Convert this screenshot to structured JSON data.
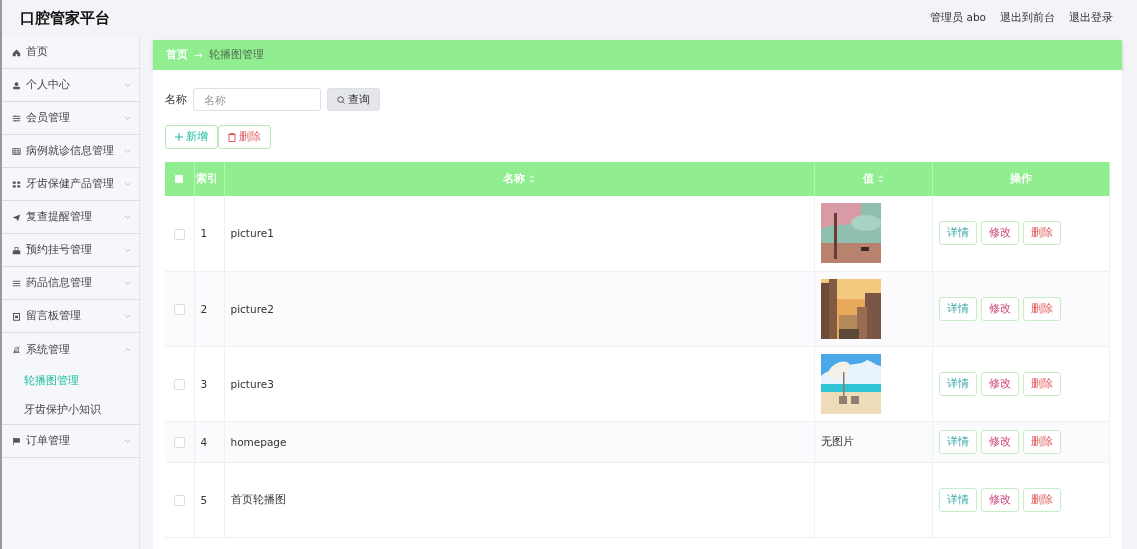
{
  "header": {
    "title": "口腔管家平台",
    "links": [
      "管理员 abo",
      "退出到前台",
      "退出登录"
    ]
  },
  "sidebar": {
    "items": [
      {
        "label": "首页"
      },
      {
        "label": "个人中心",
        "expanded": false
      },
      {
        "label": "会员管理",
        "expanded": false
      },
      {
        "label": "病例就诊信息管理",
        "expanded": false
      },
      {
        "label": "牙齿保健产品管理",
        "expanded": false
      },
      {
        "label": "复查提醒管理",
        "expanded": false
      },
      {
        "label": "预约挂号管理",
        "expanded": false
      },
      {
        "label": "药品信息管理",
        "expanded": false
      },
      {
        "label": "留言板管理",
        "expanded": false
      },
      {
        "label": "系统管理",
        "expanded": true,
        "children": [
          {
            "label": "轮播图管理",
            "selected": true
          },
          {
            "label": "牙齿保护小知识",
            "selected": false
          }
        ]
      },
      {
        "label": "订单管理",
        "expanded": false
      }
    ]
  },
  "breadcrumb": {
    "items": [
      "首页",
      "轮播图管理"
    ],
    "separator": "→"
  },
  "search": {
    "label": "名称",
    "placeholder": "名称",
    "button": "查询"
  },
  "actions": [
    {
      "kind": "add",
      "label": "新增"
    },
    {
      "kind": "delete",
      "label": "删除"
    }
  ],
  "table": {
    "header_checked": false,
    "columns": [
      {
        "label": "索引",
        "sortable": false
      },
      {
        "label": "名称",
        "sortable": true
      },
      {
        "label": "值",
        "sortable": true
      },
      {
        "label": "操作",
        "sortable": false
      }
    ],
    "rows": [
      {
        "checked": false,
        "index": "1",
        "name": "picture1",
        "value": {
          "kind": "picture"
        },
        "buttons": [
          "详情",
          "修改",
          "删除"
        ]
      },
      {
        "checked": false,
        "index": "2",
        "name": "picture2",
        "value": {
          "kind": "picture"
        },
        "buttons": [
          "详情",
          "修改",
          "删除"
        ]
      },
      {
        "checked": false,
        "index": "3",
        "name": "picture3",
        "value": {
          "kind": "picture"
        },
        "buttons": [
          "详情",
          "修改",
          "删除"
        ]
      },
      {
        "checked": false,
        "index": "4",
        "name": "homepage",
        "value": {
          "kind": "text",
          "text": "无图片"
        },
        "buttons": [
          "详情",
          "修改",
          "删除"
        ]
      },
      {
        "checked": false,
        "index": "5",
        "name": "首页轮播图",
        "value": {
          "kind": "empty"
        },
        "buttons": [
          "详情",
          "修改",
          "删除"
        ]
      }
    ]
  }
}
